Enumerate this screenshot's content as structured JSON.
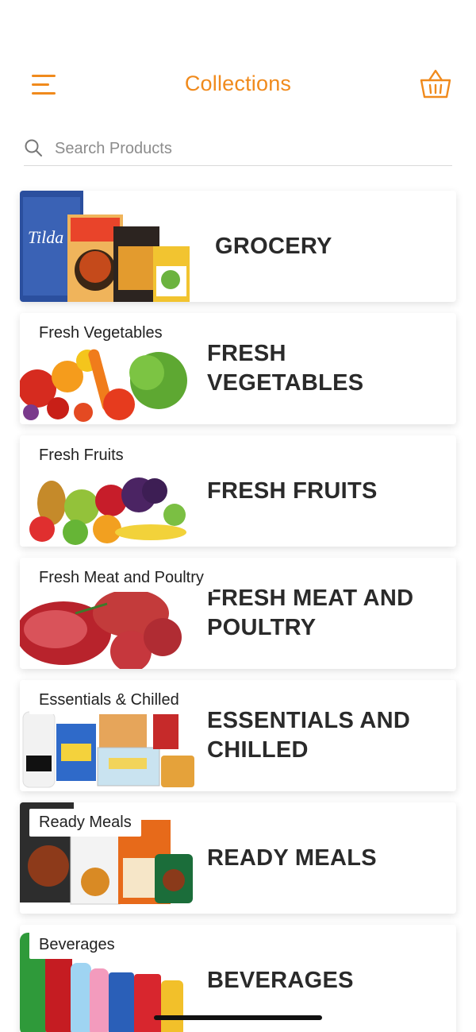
{
  "header": {
    "title": "Collections",
    "menu_icon": "hamburger-menu-icon",
    "cart_icon": "basket-icon",
    "accent_color": "#f08a1c"
  },
  "search": {
    "placeholder": "Search Products",
    "icon": "search-icon"
  },
  "collections": [
    {
      "tag": "",
      "title": "GROCERY"
    },
    {
      "tag": "Fresh Vegetables",
      "title": "FRESH VEGETABLES"
    },
    {
      "tag": "Fresh Fruits",
      "title": "FRESH FRUITS"
    },
    {
      "tag": "Fresh Meat and Poultry",
      "title": "FRESH MEAT AND POULTRY"
    },
    {
      "tag": "Essentials & Chilled",
      "title": "ESSENTIALS AND CHILLED"
    },
    {
      "tag": "Ready Meals",
      "title": "READY MEALS"
    },
    {
      "tag": "Beverages",
      "title": "BEVERAGES"
    }
  ]
}
